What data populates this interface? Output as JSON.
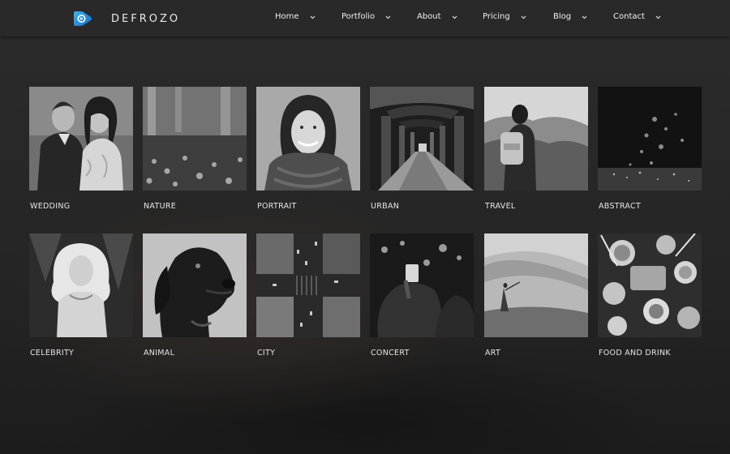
{
  "brand": {
    "name": "DEFROZO",
    "logo_icon": "play-logo-icon",
    "accent_color": "#1e8fd9"
  },
  "nav": {
    "items": [
      {
        "label": "Home",
        "icon": "chevron-down-icon"
      },
      {
        "label": "Portfolio",
        "icon": "chevron-down-icon"
      },
      {
        "label": "About",
        "icon": "chevron-down-icon"
      },
      {
        "label": "Pricing",
        "icon": "chevron-down-icon"
      },
      {
        "label": "Blog",
        "icon": "chevron-down-icon"
      },
      {
        "label": "Contact",
        "icon": "chevron-down-icon"
      }
    ]
  },
  "gallery": {
    "items": [
      {
        "label": "WEDDING"
      },
      {
        "label": "NATURE"
      },
      {
        "label": "PORTRAIT"
      },
      {
        "label": "URBAN"
      },
      {
        "label": "TRAVEL"
      },
      {
        "label": "ABSTRACT"
      },
      {
        "label": "CELEBRITY"
      },
      {
        "label": "ANIMAL"
      },
      {
        "label": "CITY"
      },
      {
        "label": "CONCERT"
      },
      {
        "label": "ART"
      },
      {
        "label": "FOOD AND DRINK"
      }
    ]
  }
}
